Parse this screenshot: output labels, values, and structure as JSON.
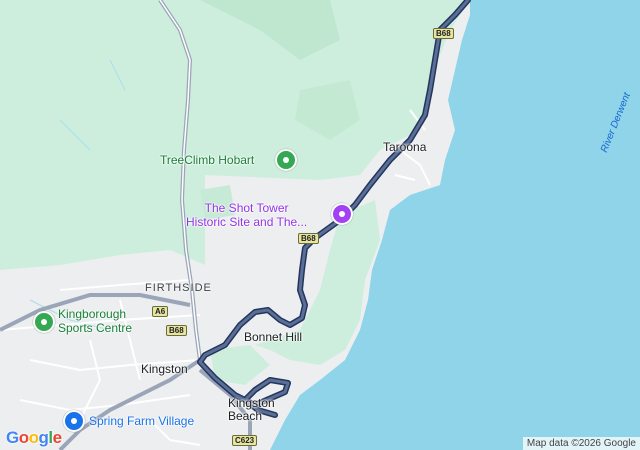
{
  "colors": {
    "water": "#8fd4e8",
    "forest": "#cdeedd",
    "urban": "#eceef0",
    "route": "#4a5f86",
    "route_outline": "#23355c",
    "highway": "#9aa5b8"
  },
  "places": {
    "taroona": "Taroona",
    "firthside": "FIRTHSIDE",
    "bonnet_hill": "Bonnet Hill",
    "kingston": "Kingston",
    "kingston_beach_1": "Kingston",
    "kingston_beach_2": "Beach"
  },
  "pois": {
    "treeclimb": "TreeClimb Hobart",
    "shot_tower_1": "The Shot Tower",
    "shot_tower_2": "Historic Site and The...",
    "kingborough_1": "Kingborough",
    "kingborough_2": "Sports Centre",
    "spring_farm": "Spring Farm Village"
  },
  "water_labels": {
    "river_derwent": "River Derwent"
  },
  "road_shields": {
    "b68_top": "B68",
    "b68_mid": "B68",
    "a6": "A6",
    "b68_left": "B68",
    "c623": "C623"
  },
  "icons": {
    "treeclimb": "park-pin-icon",
    "shot_tower": "landmark-pin-icon",
    "kingborough": "park-pin-icon",
    "spring_farm": "shopping-pin-icon"
  },
  "footer": {
    "logo_letters": [
      "G",
      "o",
      "o",
      "g",
      "l",
      "e"
    ],
    "attribution": "Map data ©2026 Google"
  }
}
